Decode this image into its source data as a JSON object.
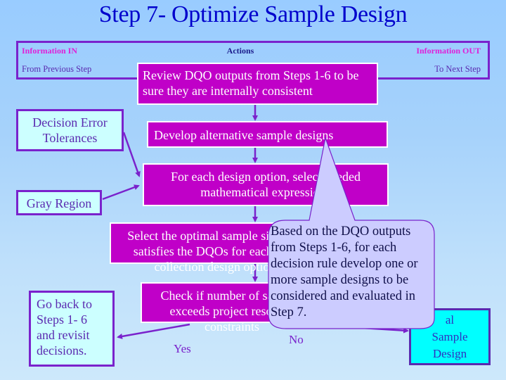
{
  "title": "Step 7- Optimize Sample Design",
  "header": {
    "information_in": "Information IN",
    "from_previous_step": "From Previous Step",
    "actions": "Actions",
    "information_out": "Information OUT",
    "to_next_step": "To Next Step"
  },
  "actions": [
    {
      "text": "Review DQO outputs from Steps 1-6 to be sure they are internally consistent"
    },
    {
      "text": "Develop alternative sample designs"
    },
    {
      "text": "For each design option, select needed mathematical expressions"
    },
    {
      "text": "Select the optimal sample size that satisfies the DQOs for each data collection design option"
    },
    {
      "text": "Check if number of samples exceeds project resource constraints"
    }
  ],
  "visible_action_text": [
    [
      "Review DQO outputs from Steps 1-6 to",
      "be sure they are internally consistent"
    ],
    [
      "Develop alternative sample designs"
    ],
    [
      "For each design option, sele",
      "eeded",
      "mathematical express"
    ],
    [
      "Select the optimal sample",
      "DQOs for each data colle"
    ],
    [
      "Check if number of sa",
      "project resource c"
    ]
  ],
  "inputs": {
    "decision_error_tolerances": "Decision Error Tolerances",
    "gray_region": "Gray Region",
    "go_back": "Go back to Steps 1- 6 and revisit decisions."
  },
  "output": {
    "label_visible": "al Sample Design",
    "lines": [
      "al",
      "Sample",
      "Design"
    ]
  },
  "branch_labels": {
    "yes": "Yes",
    "no": "No"
  },
  "callout": {
    "text": "Based on the DQO outputs from Steps 1-6, for each decision rule develop one or more sample designs to be considered and evaluated in Step 7."
  },
  "colors": {
    "title": "#0000cc",
    "action_fill": "#c000c8",
    "input_fill": "#ccffff",
    "output_fill": "#00ffff",
    "border_purple": "#7a22cc",
    "callout_fill": "#ccccff",
    "header_accent": "#e020d8"
  }
}
